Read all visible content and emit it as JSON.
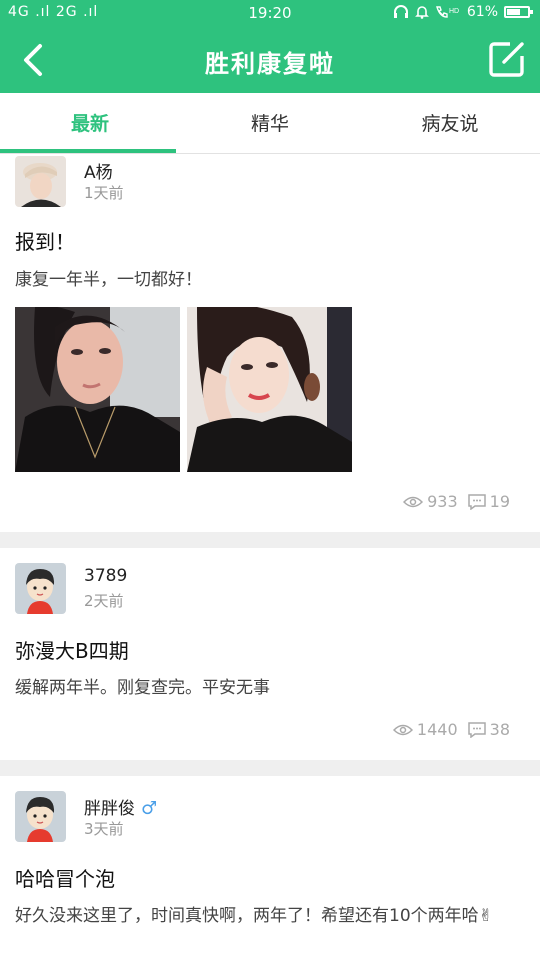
{
  "status_bar": {
    "left": "4G .ıl 2G .ıl",
    "time": "19:20",
    "battery": "61%"
  },
  "header": {
    "title": "胜利康复啦"
  },
  "tabs": [
    {
      "label": "最新"
    },
    {
      "label": "精华"
    },
    {
      "label": "病友说"
    }
  ],
  "posts": [
    {
      "user": "A杨",
      "time": "1天前",
      "title": "报到！",
      "body": "康复一年半，一切都好！",
      "views": "933",
      "comments": "19"
    },
    {
      "user": "3789",
      "time": "2天前",
      "title": "弥漫大B四期",
      "body": "缓解两年半。刚复查完。平安无事",
      "views": "1440",
      "comments": "38"
    },
    {
      "user": "胖胖俊",
      "gender": "♂",
      "time": "3天前",
      "title": "哈哈冒个泡",
      "body": "好久没来这里了，时间真快啊，两年了！希望还有10个两年哈✌"
    }
  ],
  "colors": {
    "accent": "#2ec27e",
    "male": "#4a9fe8"
  }
}
